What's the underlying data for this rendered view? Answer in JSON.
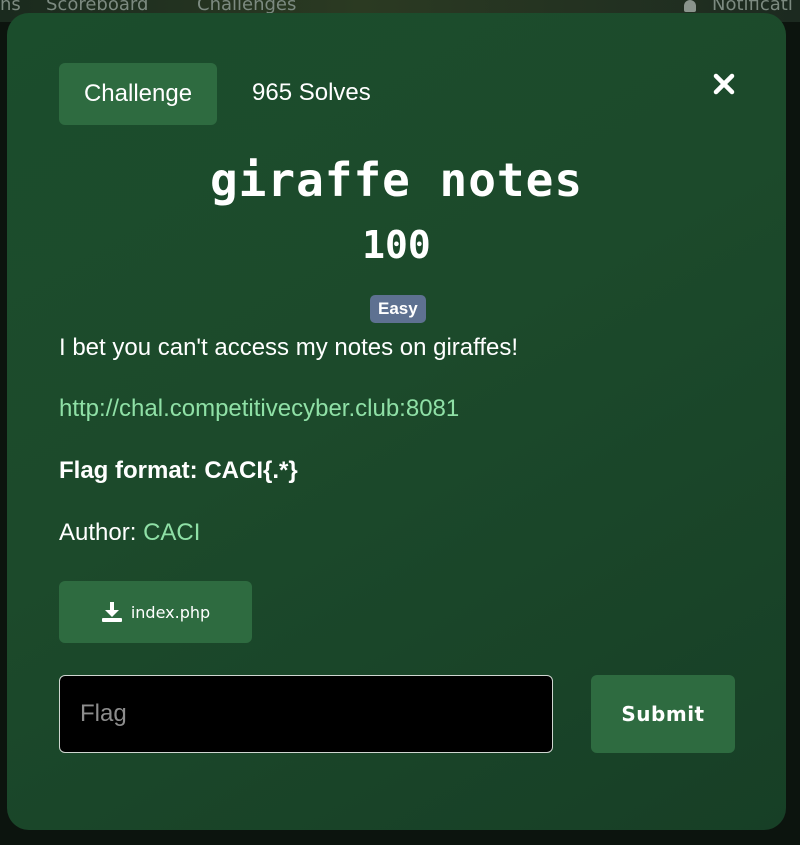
{
  "background_nav": {
    "items": [
      "ns",
      "Scoreboard",
      "Challenges",
      "Notificati"
    ]
  },
  "modal": {
    "tab_label": "Challenge",
    "solves": "965 Solves",
    "title": "giraffe notes",
    "points": "100",
    "difficulty": "Easy",
    "description": "I bet you can't access my notes on giraffes!",
    "url": "http://chal.competitivecyber.club:8081",
    "flag_format": "Flag format: CACI{.*}",
    "author_label": "Author:",
    "author_name": "CACI",
    "file_name": "index.php",
    "flag_placeholder": "Flag",
    "submit_label": "Submit"
  },
  "colors": {
    "modal_bg": "#1b4d2c",
    "button_bg": "#2e6b40",
    "link": "#8fe0a6",
    "badge": "#5e7191"
  },
  "icons": [
    "close-icon",
    "download-icon",
    "bell-icon"
  ]
}
